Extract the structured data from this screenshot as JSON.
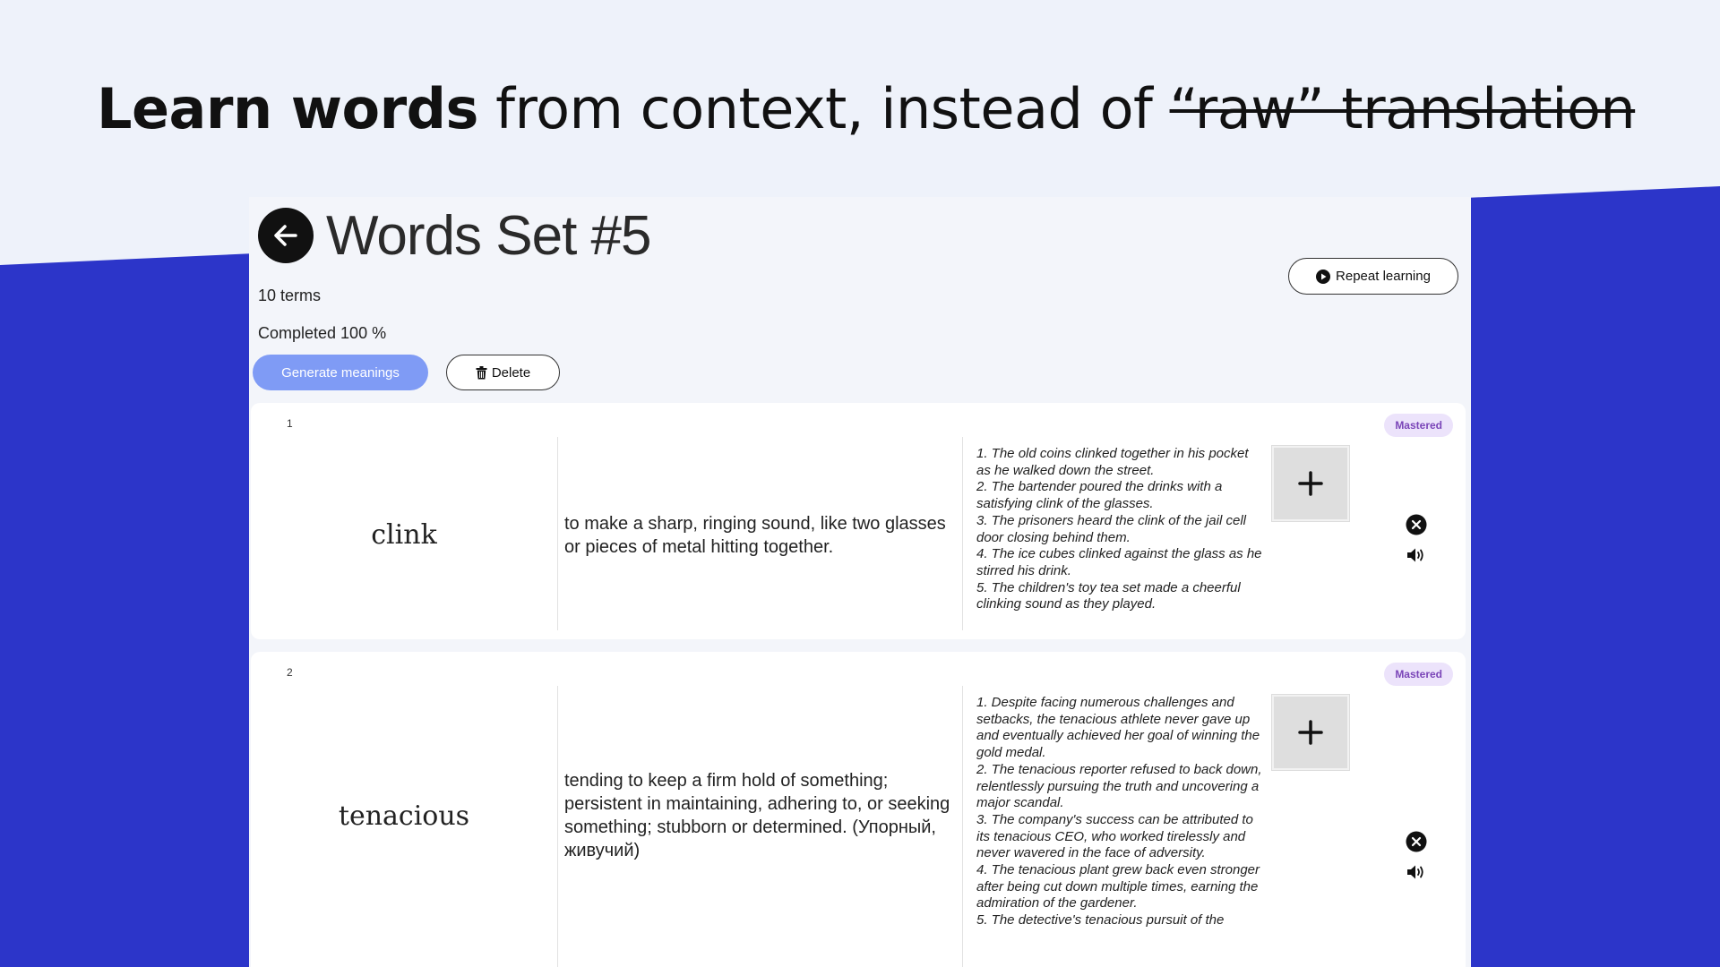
{
  "headline": {
    "bold": "Learn words",
    "regular": " from context, instead of ",
    "strike": "“raw” translation"
  },
  "colors": {
    "background_light": "#eef2fa",
    "background_blue": "#2c35c9",
    "generate_button": "#7f9bf5",
    "badge_bg": "#ece3fb",
    "badge_text": "#7a45b8"
  },
  "set": {
    "title": "Words Set #5",
    "terms": "10 terms",
    "completed": "Completed 100 %"
  },
  "actions": {
    "generate": "Generate meanings",
    "delete": "Delete",
    "repeat": "Repeat learning"
  },
  "cards": [
    {
      "index": "1",
      "status": "Mastered",
      "word": "clink",
      "definition": "to make a sharp, ringing sound, like two glasses or pieces of metal hitting together.",
      "examples": [
        "1. The old coins clinked together in his pocket as he walked down the street.",
        "2. The bartender poured the drinks with a satisfying clink of the glasses.",
        "3. The prisoners heard the clink of the jail cell door closing behind them.",
        "4. The ice cubes clinked against the glass as he stirred his drink.",
        "5. The children's toy tea set made a cheerful clinking sound as they played."
      ]
    },
    {
      "index": "2",
      "status": "Mastered",
      "word": "tenacious",
      "definition": "tending to keep a firm hold of something; persistent in maintaining, adhering to, or seeking something; stubborn or determined. (Упорный, живучий)",
      "examples": [
        "1. Despite facing numerous challenges and setbacks, the tenacious athlete never gave up and eventually achieved her goal of winning the gold medal.",
        "2. The tenacious reporter refused to back down, relentlessly pursuing the truth and uncovering a major scandal.",
        "3. The company's success can be attributed to its tenacious CEO, who worked tirelessly and never wavered in the face of adversity.",
        "4. The tenacious plant grew back even stronger after being cut down multiple times, earning the admiration of the gardener.",
        "5. The detective's tenacious pursuit of the"
      ]
    }
  ]
}
